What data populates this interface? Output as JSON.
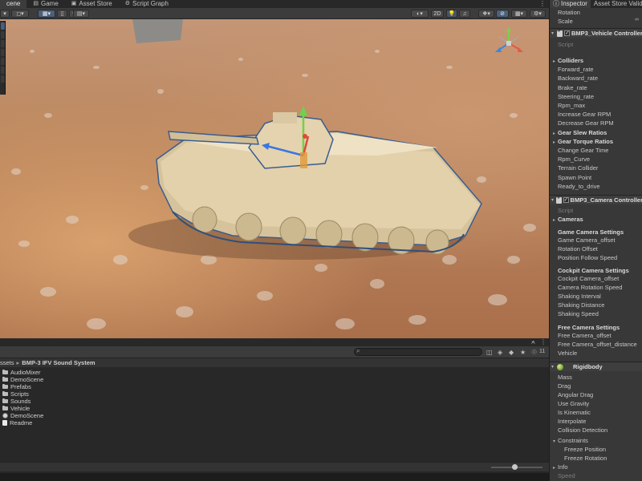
{
  "top_tabs": [
    {
      "label": "cene",
      "icon": "scene-icon",
      "active": true
    },
    {
      "label": "Game",
      "icon": "game-icon",
      "active": false
    },
    {
      "label": "Asset Store",
      "icon": "store-icon",
      "active": false
    },
    {
      "label": "Script Graph",
      "icon": "graph-icon",
      "active": false
    }
  ],
  "scene_toolbar": {
    "view_2d_label": "2D"
  },
  "inspector": {
    "tabs": [
      {
        "label": "Inspector",
        "icon": "info-icon"
      },
      {
        "label": "Asset Store Validat",
        "icon": ""
      }
    ],
    "transform_rows": [
      "Rotation",
      "Scale"
    ],
    "vehicle_controller": {
      "title": "BMP3_Vehicle Controller",
      "script_label": "Script",
      "rows": [
        {
          "label": "Colliders",
          "bold": true,
          "fold": true
        },
        {
          "label": "Forward_rate"
        },
        {
          "label": "Backward_rate"
        },
        {
          "label": "Brake_rate"
        },
        {
          "label": "Steering_rate"
        },
        {
          "label": "Rpm_max"
        },
        {
          "label": "Increase Gear RPM"
        },
        {
          "label": "Decrease Gear RPM"
        },
        {
          "label": "Gear Slew Ratios",
          "bold": true,
          "fold": true
        },
        {
          "label": "Gear Torque Ratios",
          "bold": true,
          "fold": true
        },
        {
          "label": "Change Gear Time"
        },
        {
          "label": "Rpm_Curve"
        },
        {
          "label": "Terrain Collider"
        },
        {
          "label": "Spawn Point"
        },
        {
          "label": "Ready_to_drive"
        }
      ]
    },
    "camera_controller": {
      "title": "BMP3_Camera Controller",
      "script_label": "Script",
      "cameras_label": "Cameras",
      "game_section": "Game Camera Settings",
      "game_rows": [
        "Game Camera_offset",
        "Rotation Offset",
        "Position Follow Speed"
      ],
      "cockpit_section": "Cockpit Camera Settings",
      "cockpit_rows": [
        "Cockpit Camera_offset",
        "Camera Rotation Speed",
        "Shaking Interval",
        "Shaking Distance",
        "Shaking Speed"
      ],
      "free_section": "Free Camera Settings",
      "free_rows": [
        "Free Camera_offset",
        "Free Camera_offset_distance",
        "Vehicle"
      ]
    },
    "rigidbody": {
      "title": "Rigidbody",
      "rows": [
        "Mass",
        "Drag",
        "Angular Drag",
        "Use Gravity",
        "Is Kinematic",
        "Interpolate",
        "Collision Detection"
      ],
      "constraints_label": "Constraints",
      "constraint_rows": [
        "Freeze Position",
        "Freeze Rotation"
      ],
      "info_label": "Info",
      "speed_label": "Speed"
    }
  },
  "project": {
    "hidden_count": "11",
    "breadcrumb": [
      "ssets",
      "BMP-3 IFV Sound System"
    ],
    "assets": [
      {
        "name": "AudioMixer",
        "icon": "folder-icon"
      },
      {
        "name": "DemoScene",
        "icon": "folder-icon"
      },
      {
        "name": "Prefabs",
        "icon": "folder-icon"
      },
      {
        "name": "Scripts",
        "icon": "folder-icon"
      },
      {
        "name": "Sounds",
        "icon": "folder-icon"
      },
      {
        "name": "Vehicle",
        "icon": "folder-icon"
      },
      {
        "name": "DemoScene",
        "icon": "unity-scene-icon"
      },
      {
        "name": "Readme",
        "icon": "readme-icon"
      }
    ],
    "zoom_level": 0.45
  }
}
